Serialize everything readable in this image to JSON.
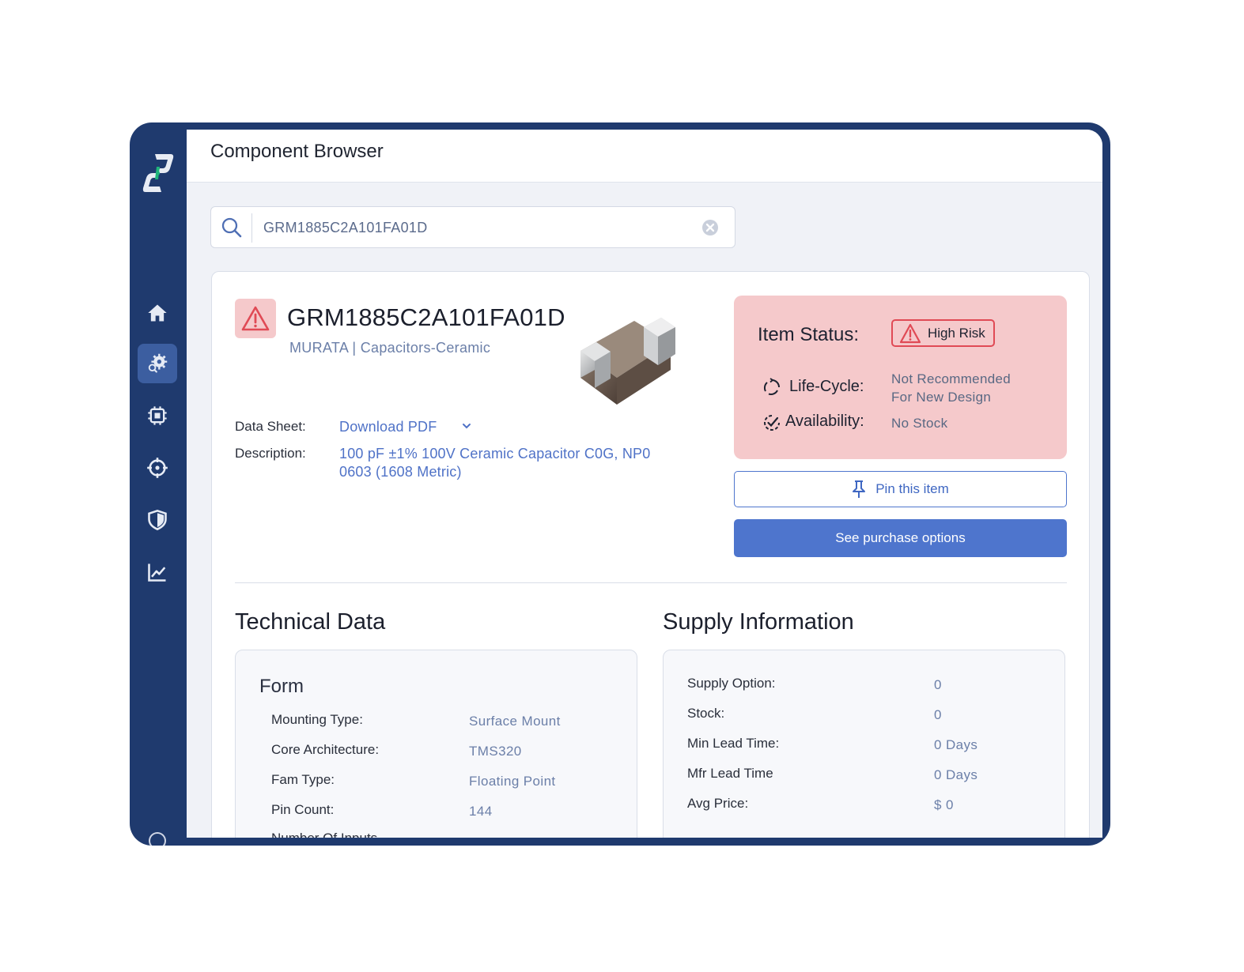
{
  "header": {
    "title": "Component Browser"
  },
  "sidebar": {
    "items": [
      {
        "name": "home",
        "icon": "home-icon"
      },
      {
        "name": "component-search",
        "icon": "gear-search-icon",
        "active": true
      },
      {
        "name": "chip",
        "icon": "chip-icon"
      },
      {
        "name": "target",
        "icon": "crosshair-icon"
      },
      {
        "name": "shield",
        "icon": "shield-icon"
      },
      {
        "name": "analytics",
        "icon": "chart-icon"
      }
    ]
  },
  "search": {
    "value": "GRM1885C2A101FA01D"
  },
  "part": {
    "number": "GRM1885C2A101FA01D",
    "meta": "MURATA | Capacitors-Ceramic",
    "datasheet_label": "Data Sheet:",
    "datasheet_link": "Download PDF",
    "description_label": "Description:",
    "description_line1": "100 pF ±1% 100V Ceramic Capacitor C0G, NP0",
    "description_line2": "0603 (1608 Metric)"
  },
  "status": {
    "title": "Item Status:",
    "risk": "High Risk",
    "lifecycle_label": "Life-Cycle:",
    "lifecycle_line1": "Not Recommended",
    "lifecycle_line2": "For New Design",
    "availability_label": "Availability:",
    "availability_value": "No Stock"
  },
  "actions": {
    "pin": "Pin this item",
    "purchase": "See purchase options"
  },
  "technical": {
    "title": "Technical Data",
    "group_title": "Form",
    "rows": [
      {
        "label": "Mounting Type:",
        "value": "Surface Mount"
      },
      {
        "label": "Core Architecture:",
        "value": "TMS320"
      },
      {
        "label": "Fam Type:",
        "value": "Floating Point"
      },
      {
        "label": "Pin Count:",
        "value": "144"
      },
      {
        "label": "Number Of Inputs",
        "value": ""
      }
    ]
  },
  "supply": {
    "title": "Supply Information",
    "rows": [
      {
        "label": "Supply Option:",
        "value": "0"
      },
      {
        "label": "Stock:",
        "value": "0"
      },
      {
        "label": "Min Lead Time:",
        "value": "0 Days"
      },
      {
        "label": "Mfr Lead Time",
        "value": "0 Days"
      },
      {
        "label": "Avg Price:",
        "value": "$ 0"
      }
    ]
  },
  "colors": {
    "sidebar": "#1f3a6e",
    "accent": "#4e75cd",
    "risk_bg": "#f5c9cb",
    "risk_border": "#e04a55"
  }
}
